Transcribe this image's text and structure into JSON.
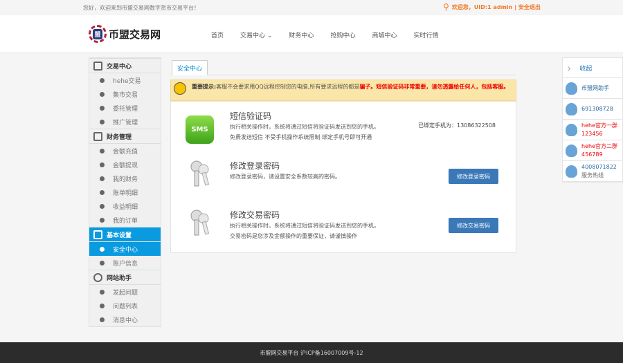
{
  "topbar": {
    "welcome": "您好，欢迎来到币盟交易网数字货币交易平台！",
    "user": "欢迎您，UID:1 admin | 安全退出"
  },
  "logo": {
    "mark": "盟",
    "text": "币盟交易网"
  },
  "nav": [
    "首页",
    "交易中心 ⌄",
    "财务中心",
    "抢购中心",
    "商城中心",
    "实时行情"
  ],
  "sidebar": {
    "groups": [
      {
        "title": "交易中心",
        "items": [
          "hehe交易",
          "集市交易",
          "委托管理",
          "推广管理"
        ]
      },
      {
        "title": "财务管理",
        "items": [
          "金额充值",
          "金额提现",
          "我的财务",
          "账单明细",
          "收益明细",
          "我的订单"
        ]
      },
      {
        "title": "基本设置",
        "items": [
          "安全中心",
          "账户信息"
        ]
      },
      {
        "title": "网站助手",
        "items": [
          "发起问题",
          "问题列表",
          "消息中心"
        ]
      }
    ]
  },
  "tab": "安全中心",
  "alert": {
    "label": "重要提示:",
    "text": "客服不会要求用QQ远程控制您的电脑,所有要求远程的都是",
    "red1": "骗子。",
    "red2": "短信验证码非常重要，请勿透露给任何人，包括客服。"
  },
  "sms": {
    "title": "短信验证码",
    "line1": "执行相关操作时，系统将通过短信将验证码发送到您的手机。",
    "line2": "免费发送短信 不受手机操作系统限制 绑定手机号即可开通",
    "phone": "已绑定手机为：13086322508",
    "icon": "SMS"
  },
  "login_pwd": {
    "title": "修改登录密码",
    "line1": "修改登录密码，请设置安全系数较高的密码。",
    "button": "修改登录密码"
  },
  "trade_pwd": {
    "title": "修改交易密码",
    "line1": "执行相关操作时，系统将通过短信将验证码发送到您的手机。",
    "line2": "交易密码是您涉及金额操作的重要保证，请谨慎操作",
    "button": "修改交易密码"
  },
  "right": {
    "collapse": "收起",
    "items": [
      [
        "币盟网助手",
        ""
      ],
      [
        "691308728",
        ""
      ],
      [
        "hehe官方一群",
        "123456"
      ],
      [
        "hehe官方二群",
        "456789"
      ],
      [
        "4008071822",
        "服务热线"
      ]
    ]
  },
  "footer": "币盟网交易平台 沪ICP备16007009号-12"
}
